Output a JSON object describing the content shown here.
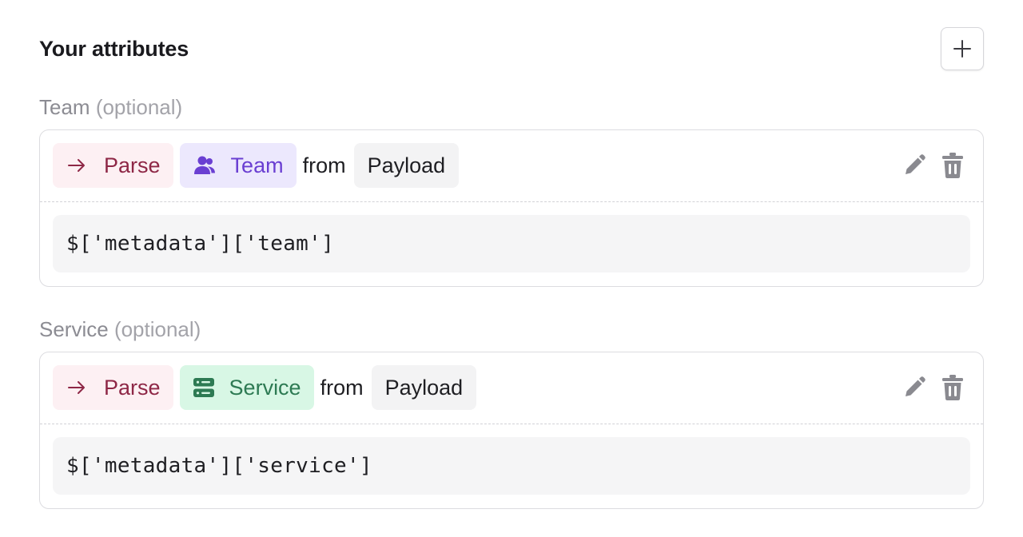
{
  "section": {
    "title": "Your attributes"
  },
  "attributes": [
    {
      "label": "Team",
      "optional": "(optional)",
      "operation": "Parse",
      "type_label": "Team",
      "from": "from",
      "source": "Payload",
      "expression": "$['metadata']['team']",
      "icon": "users-icon",
      "accent": "#6a3fd2"
    },
    {
      "label": "Service",
      "optional": "(optional)",
      "operation": "Parse",
      "type_label": "Service",
      "from": "from",
      "source": "Payload",
      "expression": "$['metadata']['service']",
      "icon": "server-icon",
      "accent": "#2d7a53"
    }
  ],
  "colors": {
    "parse_bg": "#fdf0f3",
    "parse_text": "#8e2746",
    "team_bg": "#ece8fd",
    "service_bg": "#d8f7e5",
    "source_bg": "#f3f3f4",
    "icon_gray": "#8a8a90"
  }
}
